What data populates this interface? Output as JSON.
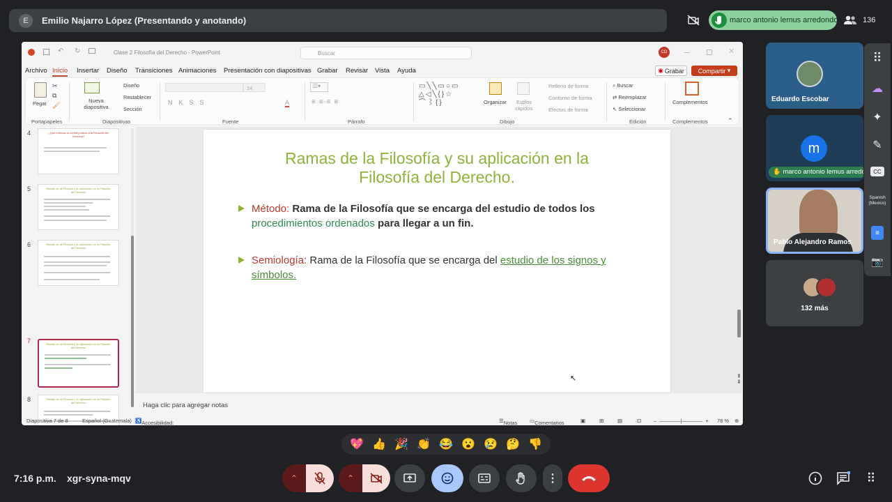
{
  "meet": {
    "presenter_initial": "E",
    "presenter_name": "Emilio Najarro López (Presentando y anotando)",
    "hand_raised_name": "marco antonio lemus arredondo",
    "participant_count": "136",
    "time": "7:16 p.m.",
    "meeting_code": "xgr-syna-mqv",
    "more_participants": "132 más",
    "caption_language": "Spanish (Mexico)",
    "reactions": [
      "💖",
      "👍",
      "🎉",
      "👏",
      "😂",
      "😮",
      "😢",
      "🤔",
      "👎"
    ]
  },
  "tiles": [
    {
      "name": "Eduardo Escobar"
    },
    {
      "name": "marco antonio lemus arredondo",
      "initial": "m"
    },
    {
      "name": "Pablo Alejandro Ramos"
    }
  ],
  "ppt": {
    "window_title": "Clase 2 Filosofía del Derecho  -  PowerPoint",
    "search_placeholder": "Buscar",
    "user_initials": "CD",
    "menu": [
      "Archivo",
      "Inicio",
      "Insertar",
      "Diseño",
      "Transiciones",
      "Animaciones",
      "Presentación con diapositivas",
      "Grabar",
      "Revisar",
      "Vista",
      "Ayuda"
    ],
    "grabar_btn": "Grabar",
    "compartir_btn": "Compartir",
    "ribbon": {
      "pegar": "Pegar",
      "nueva_diapositiva": "Nueva diapositiva",
      "diseno": "Diseño",
      "restablecer": "Restablecer",
      "seccion": "Sección",
      "font_size": "24",
      "organizar": "Organizar",
      "estilos": "Estilos rápidos",
      "relleno": "Relleno de forma",
      "contorno": "Contorno de forma",
      "efectos": "Efectos de forma",
      "buscar": "Buscar",
      "reemplazar": "Reemplazar",
      "seleccionar": "Seleccionar",
      "complementos": "Complementos",
      "groups": [
        "Portapapeles",
        "Diapositivas",
        "Fuente",
        "Párrafo",
        "Dibujo",
        "Edición",
        "Complementos"
      ]
    },
    "thumb_numbers": [
      "4",
      "5",
      "6",
      "7",
      "8"
    ],
    "thumb4_title": "¿Qué interesa la norma jurídica a la Filosofía del Derecho?",
    "thumb_title": "Ramas de la Filosofía y su aplicación en la Filosofía del Derecho",
    "slide": {
      "title": "Ramas de la Filosofía y su aplicación en la Filosofía del Derecho.",
      "b1_label": "Método:",
      "b1_text": " Rama de la Filosofía que se encarga del estudio de todos los ",
      "b1_green": "procedimientos ordenados",
      "b1_end": " para llegar a un fin.",
      "b2_label": "Semiología:",
      "b2_text": " Rama de la Filosofía que se encarga del ",
      "b2_link": "estudio de los signos y símbolos."
    },
    "notes_placeholder": "Haga clic para agregar notas",
    "status": {
      "slide": "Diapositiva 7 de 8",
      "language": "Español (Guatemala)",
      "accessibility": "Accesibilidad: es necesario investigar",
      "notas": "Notas",
      "comentarios": "Comentarios",
      "zoom": "78 %"
    }
  }
}
